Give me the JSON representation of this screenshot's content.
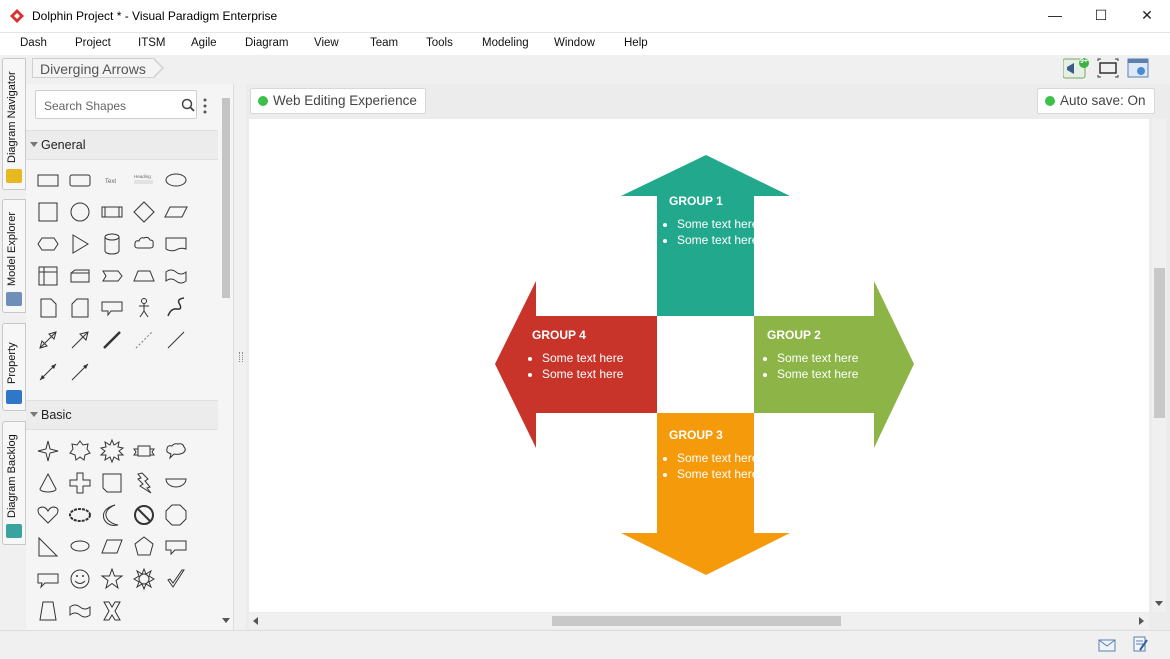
{
  "window": {
    "title": "Dolphin Project * - Visual Paradigm Enterprise",
    "minimize": "—",
    "maximize": "☐",
    "close": "✕"
  },
  "menu": [
    "Dash",
    "Project",
    "ITSM",
    "Agile",
    "Diagram",
    "View",
    "Team",
    "Tools",
    "Modeling",
    "Window",
    "Help"
  ],
  "side_tabs": [
    "Diagram Navigator",
    "Model Explorer",
    "Property",
    "Diagram Backlog"
  ],
  "breadcrumb": "Diverging Arrows",
  "toolbar": {
    "notification_badge": "9+"
  },
  "palette": {
    "search_placeholder": "Search Shapes",
    "sections": [
      "General",
      "Basic"
    ],
    "general_text_shape": "Text",
    "general_heading_shape": "Heading"
  },
  "canvas": {
    "web_editing": "Web Editing Experience",
    "autosave": "Auto save: On"
  },
  "diagram": {
    "groups": [
      {
        "title": "GROUP 1",
        "items": [
          "Some text here",
          "Some text here"
        ],
        "color": "#22a98d"
      },
      {
        "title": "GROUP 2",
        "items": [
          "Some text here",
          "Some text here"
        ],
        "color": "#8db446"
      },
      {
        "title": "GROUP 3",
        "items": [
          "Some text here",
          "Some text here"
        ],
        "color": "#f59a0b"
      },
      {
        "title": "GROUP 4",
        "items": [
          "Some text here",
          "Some text here"
        ],
        "color": "#c8342a"
      }
    ]
  },
  "colors": {
    "accent": "#c8342a",
    "green_dot": "#3cc04a"
  }
}
